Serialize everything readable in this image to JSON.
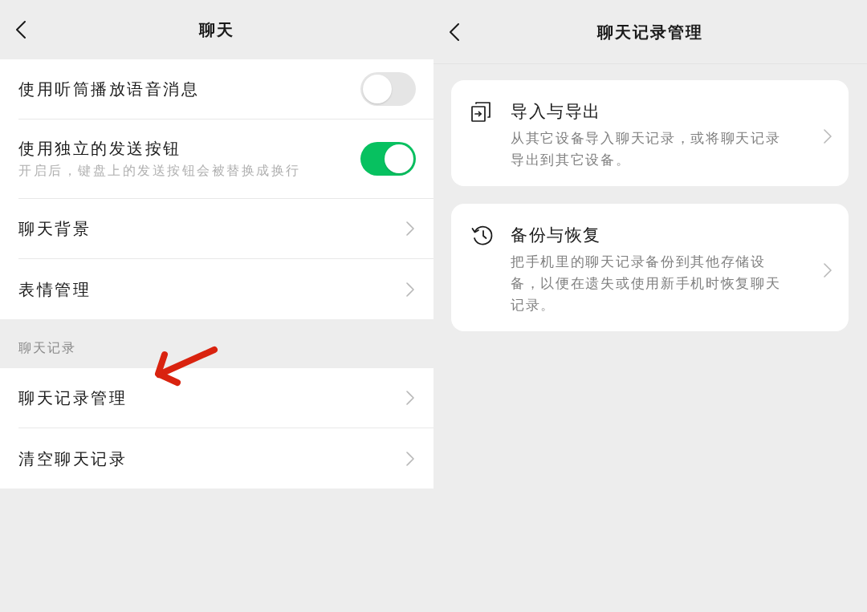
{
  "settings_screen": {
    "title": "聊天",
    "groups": [
      {
        "rows": [
          {
            "kind": "toggle",
            "label": "使用听筒播放语音消息",
            "on": false
          },
          {
            "kind": "toggle",
            "label": "使用独立的发送按钮",
            "description": "开启后，键盘上的发送按钮会被替换成换行",
            "on": true
          },
          {
            "kind": "link",
            "label": "聊天背景"
          },
          {
            "kind": "link",
            "label": "表情管理"
          }
        ]
      },
      {
        "header": "聊天记录",
        "rows": [
          {
            "kind": "link",
            "label": "聊天记录管理"
          },
          {
            "kind": "link",
            "label": "清空聊天记录"
          }
        ]
      }
    ]
  },
  "history_screen": {
    "title": "聊天记录管理",
    "cards": [
      {
        "kind": "import_export",
        "title": "导入与导出",
        "description": "从其它设备导入聊天记录，或将聊天记录导出到其它设备。"
      },
      {
        "kind": "backup",
        "title": "备份与恢复",
        "description": "把手机里的聊天记录备份到其他存储设备，以便在遗失或使用新手机时恢复聊天记录。"
      }
    ]
  }
}
